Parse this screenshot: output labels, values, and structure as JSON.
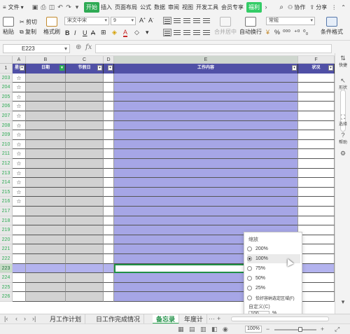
{
  "menubar": {
    "file": "文件",
    "tabs": [
      "开始",
      "插入",
      "页面布局",
      "公式",
      "数据",
      "审阅",
      "视图",
      "开发工具",
      "会员专享",
      "福利"
    ],
    "search_icon": "search-icon",
    "collab": "协作",
    "share": "分享"
  },
  "toolbar": {
    "paste": "粘贴",
    "cut": "剪切",
    "copy": "复制",
    "format_painter": "格式刷",
    "font_name": "宋文中宋",
    "font_size": "9",
    "bold": "B",
    "italic": "I",
    "underline": "U",
    "merge_center": "合并居中",
    "wrap": "自动换行",
    "number_format": "常规",
    "conditional_format": "条件格式"
  },
  "formula_bar": {
    "name_box": "E223",
    "fx": "fx"
  },
  "columns": [
    {
      "letter": "A",
      "header": "星级"
    },
    {
      "letter": "B",
      "header": "日期"
    },
    {
      "letter": "C",
      "header": "节假日"
    },
    {
      "letter": "D",
      "header": ""
    },
    {
      "letter": "E",
      "header": "工作内容"
    },
    {
      "letter": "F",
      "header": "状况"
    }
  ],
  "rows": [
    {
      "num": "1",
      "header": true
    },
    {
      "num": "203",
      "star": "☆"
    },
    {
      "num": "204",
      "star": "☆"
    },
    {
      "num": "205",
      "star": "☆"
    },
    {
      "num": "206",
      "star": "☆"
    },
    {
      "num": "207",
      "star": "☆"
    },
    {
      "num": "208",
      "star": "☆"
    },
    {
      "num": "209",
      "star": "☆"
    },
    {
      "num": "210",
      "star": "☆"
    },
    {
      "num": "211",
      "star": "☆"
    },
    {
      "num": "212",
      "star": "☆"
    },
    {
      "num": "213",
      "star": "☆"
    },
    {
      "num": "214",
      "star": "☆"
    },
    {
      "num": "215",
      "star": "☆"
    },
    {
      "num": "216",
      "star": "☆"
    },
    {
      "num": "217",
      "star": ""
    },
    {
      "num": "218",
      "star": ""
    },
    {
      "num": "219",
      "star": ""
    },
    {
      "num": "220",
      "star": ""
    },
    {
      "num": "221",
      "star": ""
    },
    {
      "num": "222",
      "star": ""
    },
    {
      "num": "223",
      "star": "",
      "selected": true
    },
    {
      "num": "224",
      "star": ""
    },
    {
      "num": "225",
      "star": ""
    },
    {
      "num": "226",
      "star": ""
    }
  ],
  "zoom_popup": {
    "title": "缩放",
    "options": [
      "200%",
      "100%",
      "75%",
      "50%",
      "25%",
      "恰好容纳选定区域(F)"
    ],
    "selected": "100%",
    "custom_label": "自定义(C)",
    "custom_value": "100",
    "custom_unit": "%"
  },
  "right_panel": [
    "快捷",
    "形状",
    "选择",
    "帮助"
  ],
  "sheet_tabs": [
    "月工作计划",
    "日工作完成情况",
    "备忘录",
    "年度计"
  ],
  "active_sheet": "备忘录",
  "status": {
    "zoom": "100%"
  },
  "colors": {
    "green": "#2eaa54",
    "header_blue": "#5050a6",
    "content_purple": "#a6a6e6",
    "row_gray": "#d2d2d2"
  }
}
